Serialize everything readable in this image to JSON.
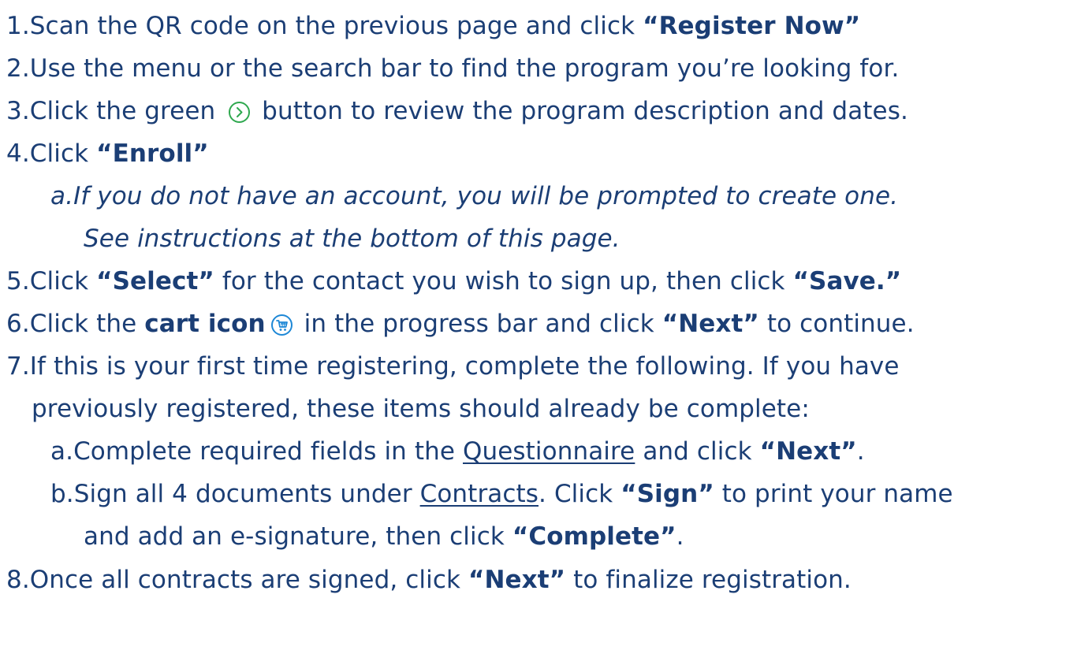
{
  "colors": {
    "text": "#1b3e75",
    "green_icon": "#2fa84f",
    "cart_icon": "#1e88d6"
  },
  "icons": {
    "green_button": "chevron-circle-right-icon",
    "cart": "cart-circle-icon"
  },
  "steps": {
    "s1": {
      "num": "1.",
      "text": "Scan the QR code on the previous page and click ",
      "b1": "“Register Now”"
    },
    "s2": {
      "num": "2.",
      "text": "Use the menu or the search bar to find the program you’re looking for."
    },
    "s3": {
      "num": "3.",
      "pre": "Click the green ",
      "post": " button to review the program description and dates."
    },
    "s4": {
      "num": "4.",
      "pre": "Click ",
      "b1": "“Enroll”"
    },
    "s4a": {
      "num": "a.",
      "line1": "If you do not have an account, you will be prompted to create one.",
      "line2": "See instructions at the bottom of this page."
    },
    "s5": {
      "num": "5.",
      "pre": "Click ",
      "b1": "“Select”",
      "mid": " for the contact you wish to sign up, then click ",
      "b2": "“Save.”"
    },
    "s6": {
      "num": "6.",
      "pre": "Click the ",
      "b1": "cart icon",
      "mid": " in the progress bar and click ",
      "b2": "“Next”",
      "post": " to continue."
    },
    "s7": {
      "num": "7.",
      "line1": "If this is your first time registering, complete the following. If you have",
      "line2": "previously registered, these items should already be complete:"
    },
    "s7a": {
      "num": "a.",
      "pre": "Complete required fields in the ",
      "u1": "Questionnaire",
      "mid": " and click ",
      "b1": "“Next”",
      "post": "."
    },
    "s7b": {
      "num": "b.",
      "pre": "Sign all 4 documents under ",
      "u1": "Contracts",
      "mid": ". Click ",
      "b1": "“Sign”",
      "post": " to print your name",
      "line2_pre": "and add an e-signature, then click ",
      "line2_b": "“Complete”",
      "line2_post": "."
    },
    "s8": {
      "num": "8.",
      "pre": "Once all contracts are signed, click ",
      "b1": "“Next”",
      "post": " to finalize registration."
    }
  }
}
